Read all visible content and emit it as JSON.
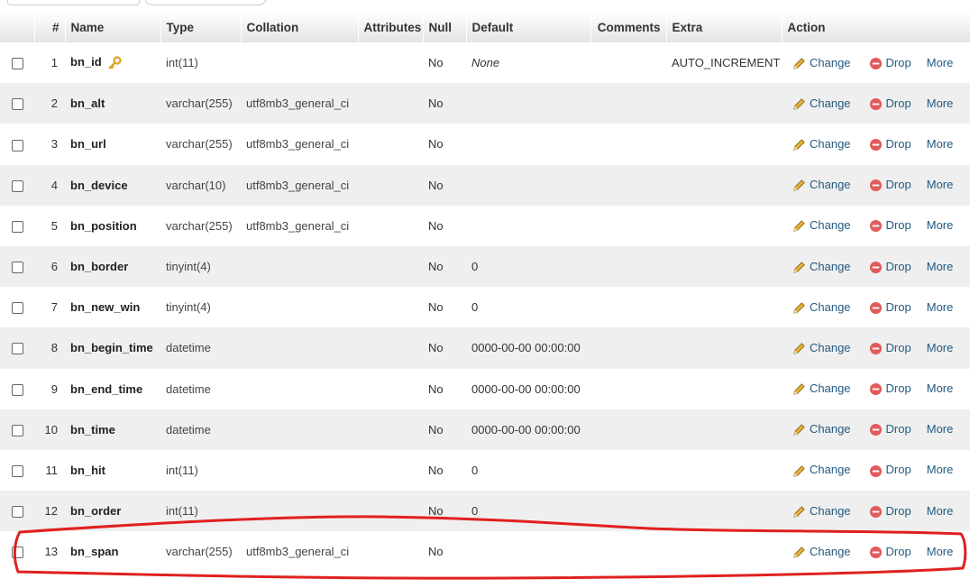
{
  "table": {
    "headers": {
      "num": "#",
      "name": "Name",
      "type": "Type",
      "collation": "Collation",
      "attributes": "Attributes",
      "null": "Null",
      "default": "Default",
      "comments": "Comments",
      "extra": "Extra",
      "action": "Action"
    },
    "action_labels": {
      "change": "Change",
      "drop": "Drop",
      "more": "More"
    },
    "rows": [
      {
        "num": "1",
        "name": "bn_id",
        "type": "int(11)",
        "collation": "",
        "null": "No",
        "default": "None",
        "extra": "AUTO_INCREMENT",
        "primary_key": true
      },
      {
        "num": "2",
        "name": "bn_alt",
        "type": "varchar(255)",
        "collation": "utf8mb3_general_ci",
        "null": "No",
        "default": "",
        "extra": ""
      },
      {
        "num": "3",
        "name": "bn_url",
        "type": "varchar(255)",
        "collation": "utf8mb3_general_ci",
        "null": "No",
        "default": "",
        "extra": ""
      },
      {
        "num": "4",
        "name": "bn_device",
        "type": "varchar(10)",
        "collation": "utf8mb3_general_ci",
        "null": "No",
        "default": "",
        "extra": ""
      },
      {
        "num": "5",
        "name": "bn_position",
        "type": "varchar(255)",
        "collation": "utf8mb3_general_ci",
        "null": "No",
        "default": "",
        "extra": ""
      },
      {
        "num": "6",
        "name": "bn_border",
        "type": "tinyint(4)",
        "collation": "",
        "null": "No",
        "default": "0",
        "extra": ""
      },
      {
        "num": "7",
        "name": "bn_new_win",
        "type": "tinyint(4)",
        "collation": "",
        "null": "No",
        "default": "0",
        "extra": ""
      },
      {
        "num": "8",
        "name": "bn_begin_time",
        "type": "datetime",
        "collation": "",
        "null": "No",
        "default": "0000-00-00 00:00:00",
        "extra": ""
      },
      {
        "num": "9",
        "name": "bn_end_time",
        "type": "datetime",
        "collation": "",
        "null": "No",
        "default": "0000-00-00 00:00:00",
        "extra": ""
      },
      {
        "num": "10",
        "name": "bn_time",
        "type": "datetime",
        "collation": "",
        "null": "No",
        "default": "0000-00-00 00:00:00",
        "extra": ""
      },
      {
        "num": "11",
        "name": "bn_hit",
        "type": "int(11)",
        "collation": "",
        "null": "No",
        "default": "0",
        "extra": ""
      },
      {
        "num": "12",
        "name": "bn_order",
        "type": "int(11)",
        "collation": "",
        "null": "No",
        "default": "0",
        "extra": ""
      },
      {
        "num": "13",
        "name": "bn_span",
        "type": "varchar(255)",
        "collation": "utf8mb3_general_ci",
        "null": "No",
        "default": "",
        "extra": ""
      }
    ]
  },
  "colors": {
    "link": "#235a81",
    "stripe": "#efefef",
    "highlight": "#e02020",
    "drop_icon": "#e25b5b",
    "pencil": "#e8b23a"
  },
  "annotation": {
    "highlighted_row": 13
  }
}
